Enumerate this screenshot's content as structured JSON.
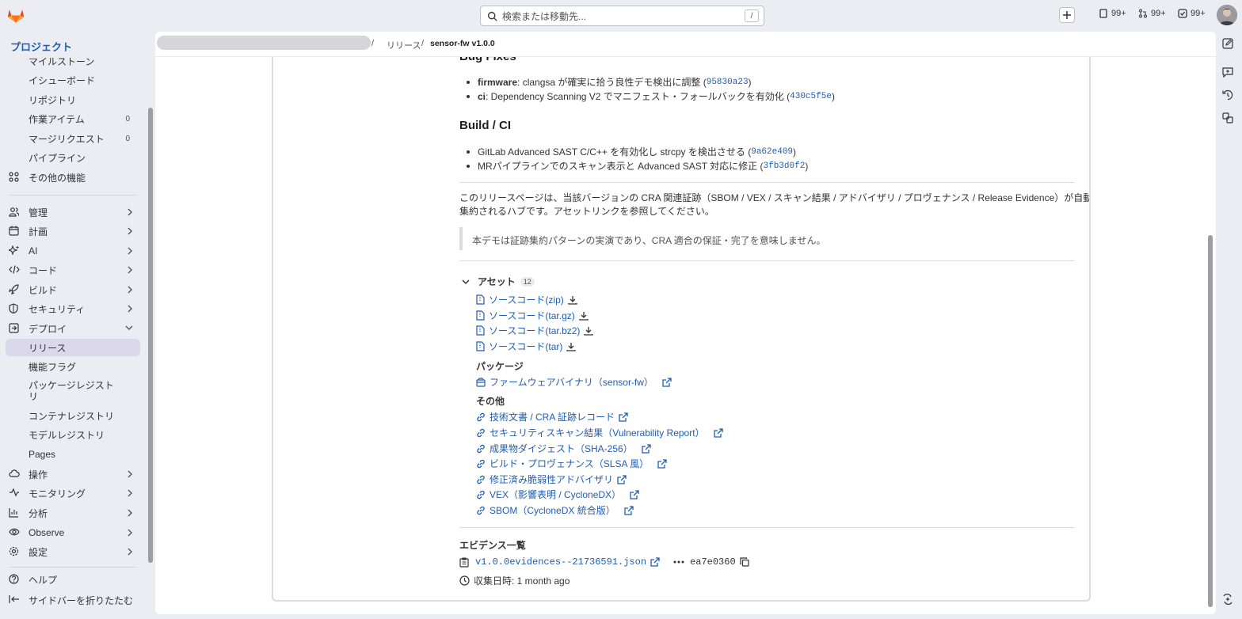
{
  "search": {
    "placeholder": "検索または移動先...",
    "shortcut": "/"
  },
  "topbar": {
    "counters": [
      {
        "icon": "issues-icon",
        "value": "99+"
      },
      {
        "icon": "merge-request-icon",
        "value": "99+"
      },
      {
        "icon": "todo-icon",
        "value": "99+"
      }
    ]
  },
  "sidebar": {
    "title": "プロジェクト",
    "sub_items": [
      {
        "label": "マイルストーン"
      },
      {
        "label": "イシューボード"
      },
      {
        "label": "リポジトリ"
      },
      {
        "label": "作業アイテム",
        "badge": "0"
      },
      {
        "label": "マージリクエスト",
        "badge": "0"
      },
      {
        "label": "パイプライン"
      }
    ],
    "more": "その他の機能",
    "groups": [
      {
        "label": "管理",
        "icon": "users-icon"
      },
      {
        "label": "計画",
        "icon": "calendar-icon"
      },
      {
        "label": "AI",
        "icon": "ai-icon"
      },
      {
        "label": "コード",
        "icon": "code-icon"
      },
      {
        "label": "ビルド",
        "icon": "rocket-icon"
      },
      {
        "label": "セキュリティ",
        "icon": "shield-icon"
      },
      {
        "label": "デプロイ",
        "icon": "deploy-icon"
      }
    ],
    "deploy_items": [
      {
        "label": "リリース",
        "active": true
      },
      {
        "label": "機能フラグ"
      },
      {
        "label": "パッケージレジストリ"
      },
      {
        "label": "コンテナレジストリ"
      },
      {
        "label": "モデルレジストリ"
      },
      {
        "label": "Pages"
      }
    ],
    "groups2": [
      {
        "label": "操作",
        "icon": "cloud-icon"
      },
      {
        "label": "モニタリング",
        "icon": "monitor-icon"
      },
      {
        "label": "分析",
        "icon": "chart-icon"
      },
      {
        "label": "Observe",
        "icon": "eye-icon"
      },
      {
        "label": "設定",
        "icon": "gear-icon"
      }
    ],
    "help": "ヘルプ",
    "collapse": "サイドバーを折りたたむ"
  },
  "breadcrumb": {
    "sep": "/",
    "releases": "リリース",
    "current": "sensor-fw v1.0.0"
  },
  "release": {
    "bugfix_heading": "Bug Fixes",
    "bugfixes": [
      {
        "scope": "firmware",
        "text": ": clangsa が確実に拾う良性デモ検出に調整 (",
        "commit": "95830a23",
        "end": ")"
      },
      {
        "scope": "ci",
        "text": ": Dependency Scanning V2 でマニフェスト・フォールバックを有効化 (",
        "commit": "430c5f5e",
        "end": ")"
      }
    ],
    "build_heading": "Build / CI",
    "builds": [
      {
        "text": "GitLab Advanced SAST C/C++ を有効化し strcpy を検出させる (",
        "commit": "9a62e409",
        "end": ")"
      },
      {
        "text": "MRパイプラインでのスキャン表示と Advanced SAST 対応に修正 (",
        "commit": "3fb3d0f2",
        "end": ")"
      }
    ],
    "paragraph_line1": "このリリースページは、当該バージョンの CRA 関連証跡（SBOM / VEX / スキャン結果 / アドバイザリ / プロヴェナンス / Release Evidence）が自動",
    "paragraph_line2": "集約されるハブです。アセットリンクを参照してください。",
    "blockquote": "本デモは証跡集約パターンの実演であり、CRA 適合の保証・完了を意味しません。"
  },
  "assets": {
    "title": "アセット",
    "count": "12",
    "sources": [
      "ソースコード(zip)",
      "ソースコード(tar.gz)",
      "ソースコード(tar.bz2)",
      "ソースコード(tar)"
    ],
    "packages_heading": "パッケージ",
    "packages": [
      "ファームウェアバイナリ（sensor-fw）"
    ],
    "other_heading": "その他",
    "others": [
      "技術文書 / CRA 証跡レコード",
      "セキュリティスキャン結果（Vulnerability Report）",
      "成果物ダイジェスト（SHA-256）",
      "ビルド・プロヴェナンス（SLSA 風）",
      "修正済み脆弱性アドバイザリ",
      "VEX（影響表明 / CycloneDX）",
      "SBOM（CycloneDX 統合版）"
    ]
  },
  "evidence": {
    "heading": "エビデンス一覧",
    "file": "v1.0.0evidences--21736591.json",
    "sha": "ea7e0360",
    "collected_label": "収集日時: 1 month ago"
  }
}
